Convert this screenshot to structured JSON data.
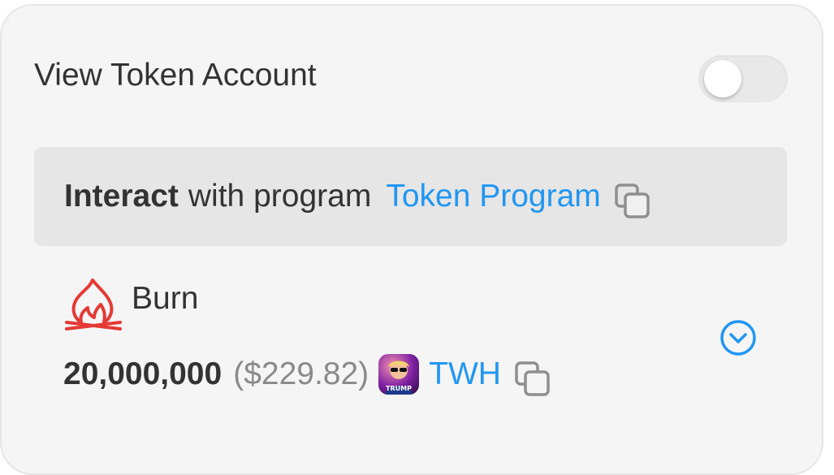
{
  "view_token_account": {
    "label": "View Token Account",
    "toggle_on": false
  },
  "interact": {
    "bold": "Interact",
    "with_text": "with program",
    "program_name": "Token Program"
  },
  "instruction": {
    "icon": "fire-icon",
    "label": "Burn",
    "amount": "20,000,000",
    "usd_value": "($229.82)",
    "token_symbol": "TWH",
    "token_avatar_text": "TRUMP"
  },
  "colors": {
    "card_background": "#f5f5f5",
    "panel_background": "#e6e6e6",
    "text": "#333333",
    "muted_text": "#8a8a8a",
    "link": "#2196f3",
    "fire": "#e53935"
  }
}
